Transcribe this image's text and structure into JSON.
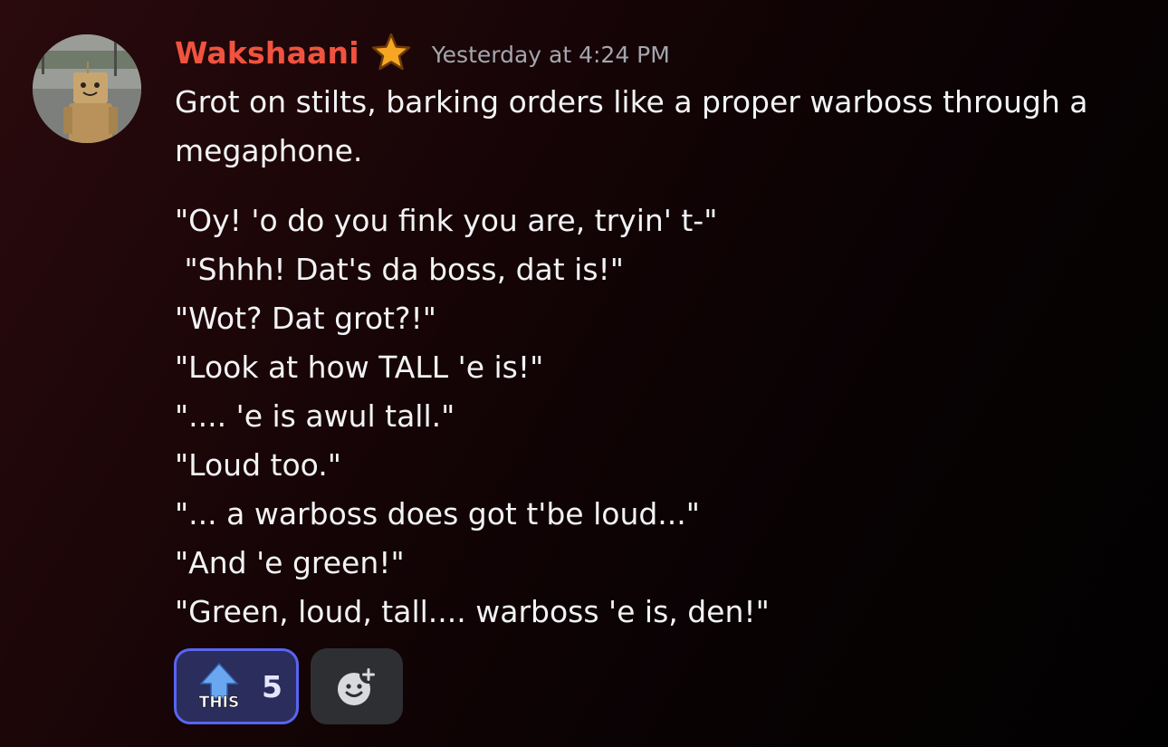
{
  "message": {
    "author": "Wakshaani",
    "timestamp": "Yesterday at 4:24 PM",
    "intro": "Grot on stilts, barking orders like a proper warboss through a megaphone.",
    "lines": [
      "\"Oy! 'o do you fink you are, tryin' t-\"",
      " \"Shhh! Dat's da boss, dat is!\"",
      "\"Wot? Dat grot?!\"",
      "\"Look at how TALL 'e is!\"",
      "\".... 'e is awul tall.\"",
      "\"Loud too.\"",
      "\"... a warboss does got t'be loud...\"",
      "\"And 'e green!\"",
      "\"Green, loud, tall.... warboss 'e is, den!\""
    ]
  },
  "reactions": [
    {
      "emoji_icon": "this-arrow-icon",
      "emoji_text": "THIS",
      "count": "5",
      "selected": true
    }
  ],
  "add_reaction_icon": "add-reaction-icon",
  "colors": {
    "username": "#f0533f",
    "timestamp": "#a3a6ad",
    "reaction_border": "#5865f2",
    "reaction_bg": "#2b2d5c",
    "star": "#f6a623"
  }
}
